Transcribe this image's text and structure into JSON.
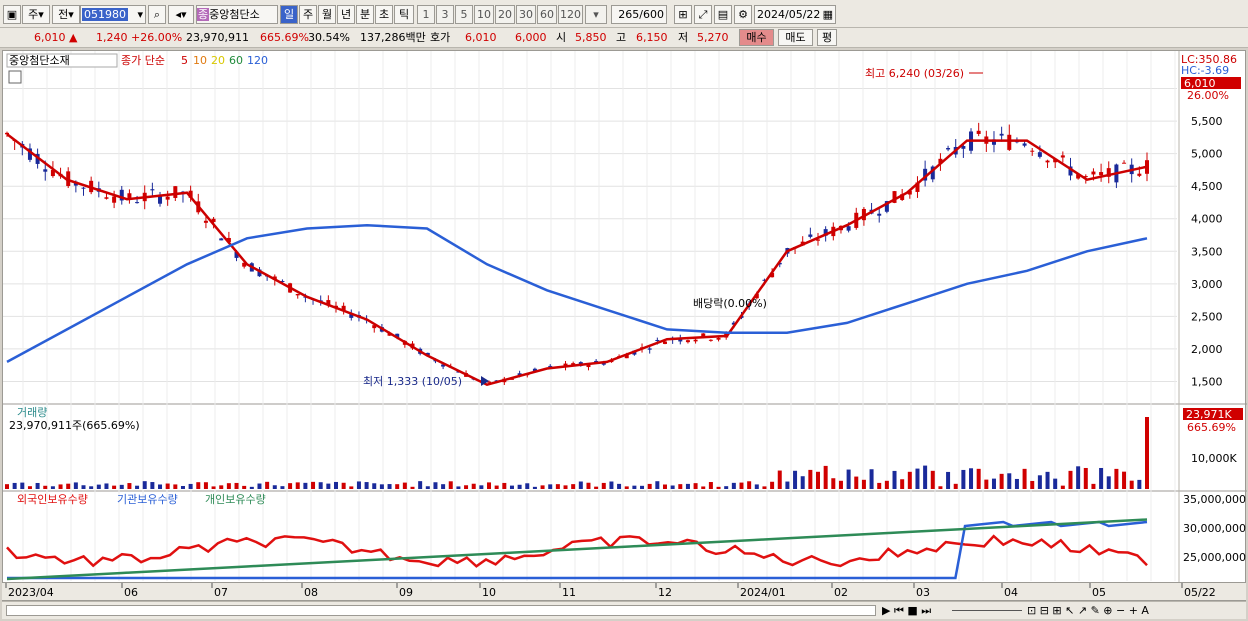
{
  "toolbar": {
    "market": "주",
    "prev": "전",
    "code": "051980",
    "stock_name": "중앙첨단소",
    "stock_badge": "종",
    "periods": [
      "일",
      "주",
      "월",
      "년",
      "분",
      "초",
      "틱"
    ],
    "intervals": [
      "1",
      "3",
      "5",
      "10",
      "20",
      "30",
      "60",
      "120"
    ],
    "count": "265",
    "count_total": "/600",
    "date": "2024/05/22"
  },
  "quote": {
    "price": "6,010",
    "change": "1,240",
    "change_pct": "+26.00%",
    "volume": "23,970,911",
    "vol_ratio": "665.69%",
    "turnover": "30.54%",
    "amount": "137,286백만",
    "hoga_label": "호가",
    "ask": "6,010",
    "bid": "6,000",
    "open_label": "시",
    "open": "5,850",
    "high_label": "고",
    "high": "6,150",
    "low_label": "저",
    "low": "5,270",
    "buy": "매수",
    "sell": "매도",
    "avg": "평"
  },
  "price_panel": {
    "name": "중앙첨단소재",
    "legend_prefix": "종가 단순",
    "ma_periods": [
      "5",
      "10",
      "20",
      "60",
      "120"
    ],
    "ma_colors": [
      "#cc0000",
      "#e07a10",
      "#f5e400",
      "#1f8a3a",
      "#2a5fd6"
    ],
    "lc": "LC:350.86",
    "hc": "HC:-3.69",
    "cur_price_tag": "6,010",
    "cur_pct_tag": "26.00%",
    "high_annot": "최고 6,240 (03/26)",
    "low_annot": "최저 1,333 (10/05)",
    "div_annot": "배당락(0.00%)"
  },
  "volume_panel": {
    "title": "거래량",
    "value": "23,970,911주(665.69%)",
    "tag": "23,971K",
    "tag_pct": "665.69%"
  },
  "holding_panel": {
    "legend": [
      "외국인보유수량",
      "기관보유수량",
      "개인보유수량"
    ],
    "colors": [
      "#e01010",
      "#2a5fd6",
      "#2e8b57"
    ]
  },
  "chart_data": [
    {
      "type": "line",
      "title": "중앙첨단소재",
      "x": [
        "2023/04",
        "06",
        "07",
        "08",
        "09",
        "10",
        "11",
        "12",
        "2024/01",
        "02",
        "03",
        "04",
        "05",
        "05/22"
      ],
      "yticks": [
        "1,500",
        "2,000",
        "2,500",
        "3,000",
        "3,500",
        "4,000",
        "4,500",
        "5,000",
        "5,500",
        "6,000"
      ],
      "ylim": [
        1200,
        6500
      ],
      "series": [
        {
          "name": "5",
          "values": [
            5300,
            4600,
            4300,
            4400,
            3300,
            2800,
            2450,
            1900,
            1450,
            1700,
            1800,
            2150,
            2200,
            3500,
            3900,
            4400,
            5200,
            5200,
            4600,
            4800
          ]
        },
        {
          "name": "120",
          "values": [
            1800,
            2300,
            2800,
            3300,
            3700,
            3850,
            3900,
            3850,
            3300,
            2900,
            2600,
            2300,
            2250,
            2250,
            2400,
            2700,
            3000,
            3200,
            3500,
            3700
          ]
        }
      ]
    },
    {
      "type": "bar",
      "title": "거래량",
      "yticks": [
        "10,000K"
      ],
      "note": "last bar 23,971K"
    },
    {
      "type": "line",
      "title": "외국인보유수량 / 기관보유수량 / 개인보유수량",
      "yticks": [
        "25,000,000",
        "30,000,000",
        "35,000,000"
      ]
    }
  ],
  "xaxis": {
    "labels": [
      "2023/04",
      "06",
      "07",
      "08",
      "09",
      "10",
      "11",
      "12",
      "2024/01",
      "02",
      "03",
      "04",
      "05",
      "05/22"
    ]
  }
}
